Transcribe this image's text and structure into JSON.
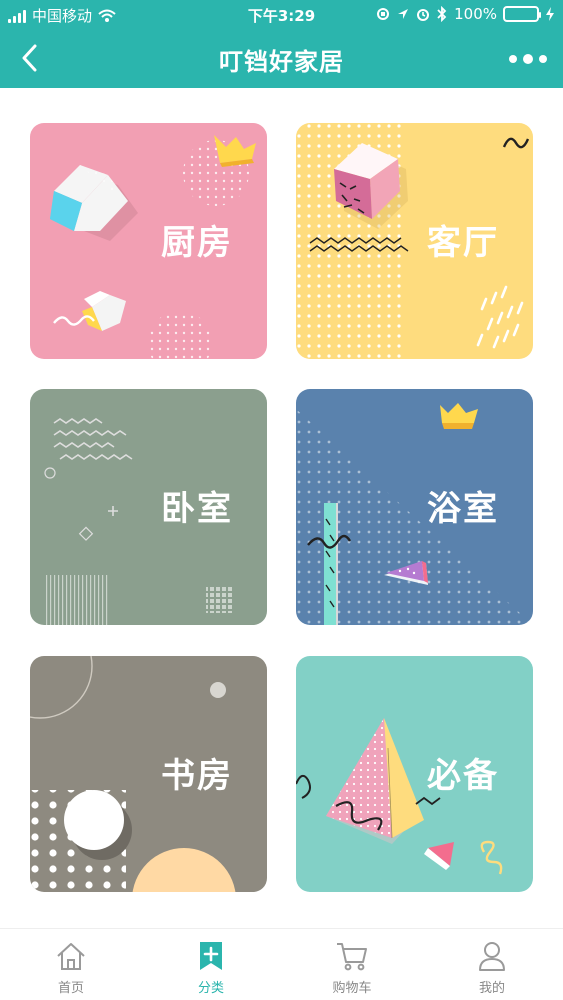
{
  "status": {
    "carrier": "中国移动",
    "time": "下午3:29",
    "battery": "100%",
    "battery_level": 1.0
  },
  "nav": {
    "title": "叮铛好家居"
  },
  "categories": [
    {
      "label": "厨房",
      "color": "#f29fb3"
    },
    {
      "label": "客厅",
      "color": "#fedc7e"
    },
    {
      "label": "卧室",
      "color": "#8b9f8e"
    },
    {
      "label": "浴室",
      "color": "#5a82ad"
    },
    {
      "label": "书房",
      "color": "#8e8a80"
    },
    {
      "label": "必备",
      "color": "#82d0c6"
    }
  ],
  "tabs": [
    {
      "label": "首页",
      "icon": "home-icon"
    },
    {
      "label": "分类",
      "icon": "category-bookmark-icon",
      "active": true
    },
    {
      "label": "购物车",
      "icon": "cart-icon"
    },
    {
      "label": "我的",
      "icon": "user-icon"
    }
  ],
  "colors": {
    "accent": "#2bb5ad",
    "tab_inactive": "#888888",
    "battery_green": "#4cd964"
  }
}
